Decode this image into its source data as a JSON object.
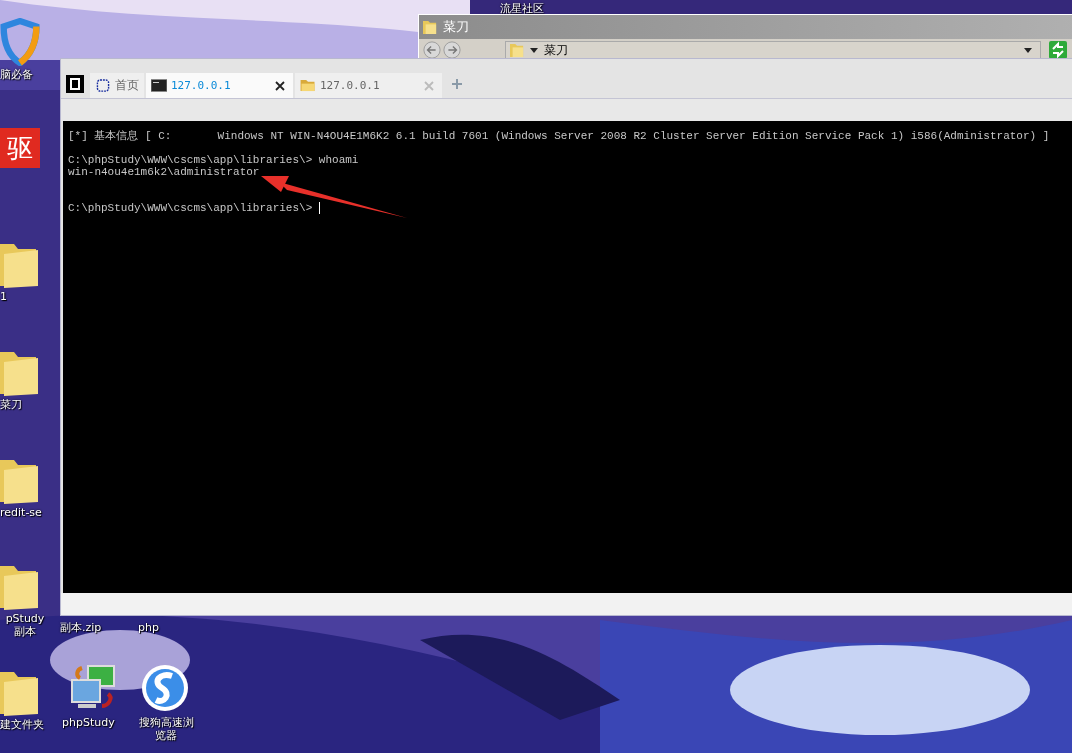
{
  "desktop": {
    "icons": [
      {
        "kind": "shield",
        "label": "脑必备"
      },
      {
        "kind": "text",
        "label": "流星社区"
      },
      {
        "kind": "badge",
        "glyph": "驱"
      },
      {
        "kind": "folder",
        "label": "1"
      },
      {
        "kind": "folder",
        "label": "菜刀"
      },
      {
        "kind": "folder",
        "label": "redit-se"
      },
      {
        "kind": "folder",
        "label": "pStudy 副本"
      },
      {
        "kind": "text",
        "label": "副本.zip"
      },
      {
        "kind": "text",
        "label": "php"
      },
      {
        "kind": "folder",
        "label": "建文件夹"
      },
      {
        "kind": "server",
        "label": "phpStudy"
      },
      {
        "kind": "browser",
        "label": "搜狗高速浏览器"
      }
    ]
  },
  "background_window": {
    "title": "菜刀",
    "address": "菜刀"
  },
  "window": {
    "tabs": [
      {
        "kind": "home",
        "label": "首页",
        "selected": false,
        "closable": false
      },
      {
        "kind": "terminal",
        "label": "127.0.0.1",
        "selected": true,
        "closable": true
      },
      {
        "kind": "folder",
        "label": "127.0.0.1",
        "selected": false,
        "closable": true
      }
    ],
    "console": {
      "lines": [
        {
          "kind": "info",
          "text": "[*] 基本信息 [ C:       Windows NT WIN-N4OU4E1M6K2 6.1 build 7601 (Windows Server 2008 R2 Cluster Server Edition Service Pack 1) i586(Administrator) ]"
        },
        {
          "kind": "command",
          "text": "C:\\phpStudy\\WWW\\cscms\\app\\libraries\\> whoami"
        },
        {
          "kind": "output",
          "text": "win-n4ou4e1m6k2\\administrator"
        },
        {
          "kind": "prompt",
          "text": "C:\\phpStudy\\WWW\\cscms\\app\\libraries\\> "
        }
      ],
      "cursor": true
    }
  }
}
